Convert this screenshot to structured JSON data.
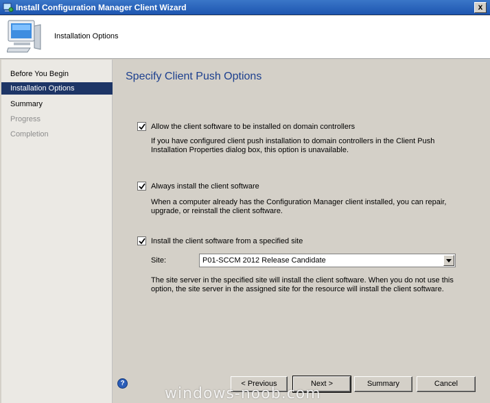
{
  "window": {
    "title": "Install Configuration Manager Client Wizard",
    "close_glyph": "x"
  },
  "banner": {
    "subtitle": "Installation Options",
    "icon": "computer-icon"
  },
  "nav": {
    "items": [
      {
        "label": "Before You Begin",
        "state": "normal"
      },
      {
        "label": "Installation Options",
        "state": "active"
      },
      {
        "label": "Summary",
        "state": "normal"
      },
      {
        "label": "Progress",
        "state": "disabled"
      },
      {
        "label": "Completion",
        "state": "disabled"
      }
    ]
  },
  "main": {
    "heading": "Specify Client Push Options",
    "options": [
      {
        "label": "Allow the client software to be installed on domain controllers",
        "checked": true,
        "desc_lines": [
          "If you have configured client push installation to domain controllers in the Client Push",
          "Installation Properties dialog box, this option is unavailable."
        ]
      },
      {
        "label": "Always install the client software",
        "checked": true,
        "desc_lines": [
          "When a computer already has the Configuration Manager client installed, you can repair,",
          "upgrade, or reinstall the client software."
        ]
      },
      {
        "label": "Install the client software from a specified site",
        "checked": true,
        "desc_lines": [
          "The site server in the specified site will install the client software.  When you do not use this",
          "option, the site server in the assigned site for the resource will install the client software."
        ]
      }
    ],
    "site": {
      "label": "Site:",
      "selected": "P01-SCCM 2012 Release Candidate"
    }
  },
  "footer": {
    "help_glyph": "?",
    "buttons": {
      "previous": "< Previous",
      "next": "Next >",
      "summary": "Summary",
      "cancel": "Cancel"
    }
  },
  "watermark": "windows-noob.com",
  "colors": {
    "title_bar": "#2a63bd",
    "heading": "#1c3f8e",
    "nav_active": "#1d3566",
    "nav_bg": "#ebe9e4",
    "dialog_bg": "#d4d0c8"
  }
}
